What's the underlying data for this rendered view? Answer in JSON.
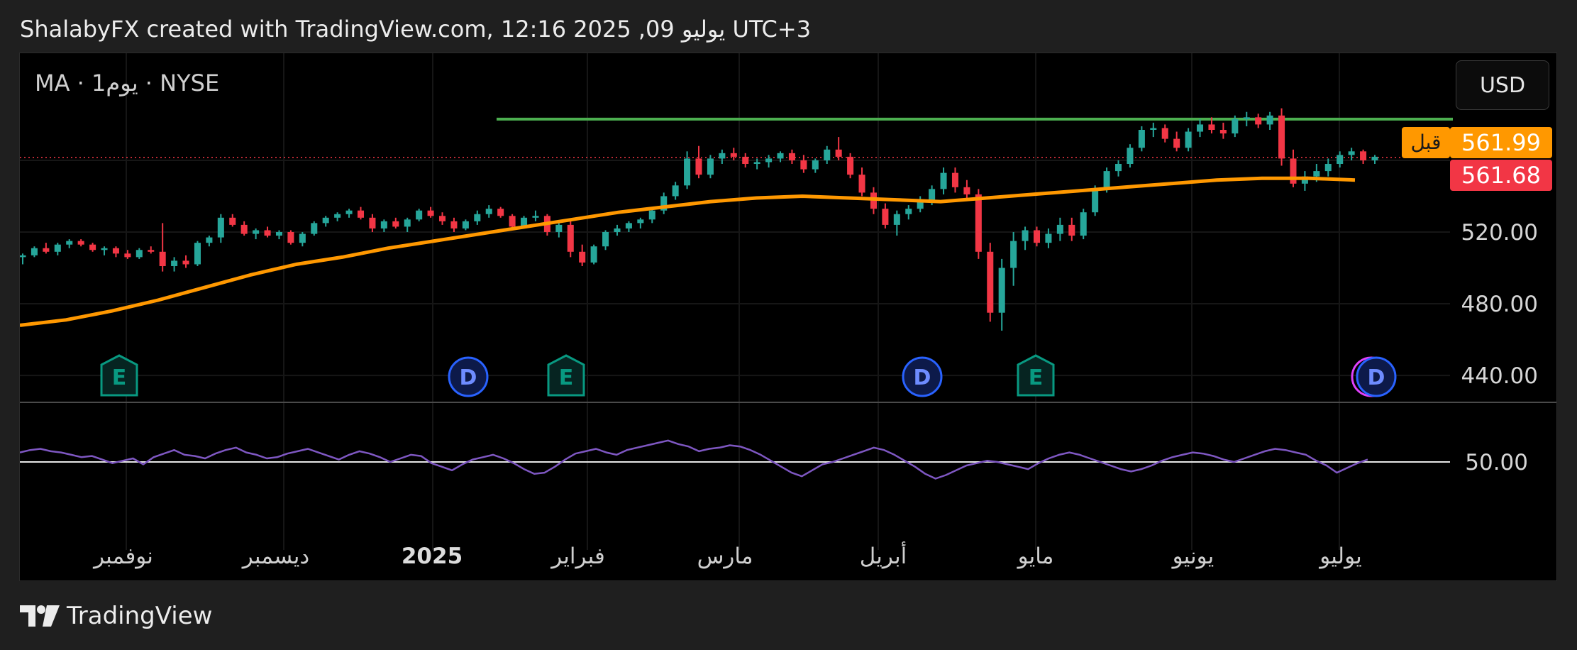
{
  "header": {
    "caption": "ShalabyFX created with TradingView.com, 12:16 2025 ,09 يوليو UTC+3"
  },
  "chart": {
    "symbol_label": "MA · 1يوم · NYSE",
    "currency": "USD",
    "prev_close_label": "قبل",
    "prev_close_value": "561.99",
    "last_price_value": "561.68",
    "colors": {
      "up": "#26a69a",
      "down": "#f23645",
      "ma": "#ff9800",
      "resistance": "#4caf50",
      "rsi": "#7e57c2",
      "prev_badge": "#ff9800",
      "last_badge": "#f23645",
      "dividend_marker": "#2962ff",
      "earnings_marker": "#089981"
    }
  },
  "chart_data": {
    "type": "line",
    "panes": [
      {
        "name": "price",
        "y_ticks": [
          "520.00",
          "480.00",
          "440.00"
        ],
        "y_tick_values": [
          520,
          480,
          440
        ],
        "ylim": [
          425,
          596
        ],
        "candles_ohlc": [
          [
            506,
            508,
            502,
            507
          ],
          [
            507,
            512,
            506,
            511
          ],
          [
            511,
            514,
            508,
            509
          ],
          [
            509,
            514,
            507,
            513
          ],
          [
            513,
            516,
            511,
            515
          ],
          [
            515,
            516,
            512,
            513
          ],
          [
            513,
            514,
            509,
            510
          ],
          [
            510,
            512,
            507,
            511
          ],
          [
            511,
            512,
            506,
            508
          ],
          [
            508,
            510,
            505,
            506
          ],
          [
            506,
            511,
            505,
            510
          ],
          [
            510,
            512,
            508,
            509
          ],
          [
            509,
            525,
            498,
            501
          ],
          [
            501,
            506,
            498,
            504
          ],
          [
            504,
            507,
            500,
            502
          ],
          [
            502,
            515,
            501,
            514
          ],
          [
            514,
            518,
            512,
            517
          ],
          [
            517,
            530,
            514,
            528
          ],
          [
            528,
            530,
            523,
            524
          ],
          [
            524,
            526,
            518,
            519
          ],
          [
            519,
            522,
            516,
            521
          ],
          [
            521,
            523,
            517,
            518
          ],
          [
            518,
            521,
            516,
            520
          ],
          [
            520,
            521,
            513,
            514
          ],
          [
            514,
            520,
            512,
            519
          ],
          [
            519,
            526,
            518,
            525
          ],
          [
            525,
            529,
            523,
            528
          ],
          [
            528,
            531,
            526,
            530
          ],
          [
            530,
            533,
            528,
            532
          ],
          [
            532,
            534,
            527,
            528
          ],
          [
            528,
            530,
            520,
            522
          ],
          [
            522,
            527,
            520,
            526
          ],
          [
            526,
            528,
            522,
            523
          ],
          [
            523,
            528,
            520,
            527
          ],
          [
            527,
            533,
            526,
            532
          ],
          [
            532,
            534,
            528,
            529
          ],
          [
            529,
            531,
            524,
            526
          ],
          [
            526,
            528,
            520,
            522
          ],
          [
            522,
            527,
            521,
            526
          ],
          [
            526,
            532,
            524,
            530
          ],
          [
            530,
            535,
            528,
            533
          ],
          [
            533,
            534,
            528,
            529
          ],
          [
            529,
            530,
            521,
            523
          ],
          [
            523,
            529,
            522,
            528
          ],
          [
            528,
            532,
            526,
            529
          ],
          [
            529,
            530,
            518,
            520
          ],
          [
            520,
            526,
            517,
            524
          ],
          [
            524,
            526,
            506,
            509
          ],
          [
            509,
            513,
            501,
            503
          ],
          [
            503,
            513,
            502,
            512
          ],
          [
            512,
            521,
            510,
            520
          ],
          [
            520,
            524,
            518,
            522
          ],
          [
            522,
            526,
            520,
            525
          ],
          [
            525,
            528,
            522,
            527
          ],
          [
            527,
            534,
            525,
            532
          ],
          [
            532,
            542,
            530,
            540
          ],
          [
            540,
            548,
            538,
            546
          ],
          [
            546,
            565,
            544,
            561
          ],
          [
            561,
            568,
            550,
            552
          ],
          [
            552,
            563,
            550,
            561
          ],
          [
            561,
            566,
            558,
            564
          ],
          [
            564,
            567,
            560,
            562
          ],
          [
            562,
            564,
            556,
            558
          ],
          [
            558,
            561,
            555,
            559
          ],
          [
            559,
            563,
            556,
            561
          ],
          [
            561,
            565,
            559,
            564
          ],
          [
            564,
            566,
            558,
            560
          ],
          [
            560,
            563,
            553,
            555
          ],
          [
            555,
            561,
            553,
            560
          ],
          [
            560,
            568,
            558,
            566
          ],
          [
            566,
            573,
            560,
            562
          ],
          [
            562,
            564,
            550,
            552
          ],
          [
            552,
            556,
            540,
            542
          ],
          [
            542,
            545,
            530,
            533
          ],
          [
            533,
            536,
            522,
            524
          ],
          [
            524,
            532,
            518,
            530
          ],
          [
            530,
            535,
            527,
            533
          ],
          [
            533,
            540,
            531,
            538
          ],
          [
            538,
            546,
            535,
            544
          ],
          [
            544,
            556,
            541,
            553
          ],
          [
            553,
            556,
            542,
            545
          ],
          [
            545,
            549,
            538,
            541
          ],
          [
            541,
            544,
            505,
            509
          ],
          [
            509,
            514,
            470,
            475
          ],
          [
            475,
            505,
            465,
            500
          ],
          [
            500,
            520,
            490,
            515
          ],
          [
            515,
            523,
            510,
            521
          ],
          [
            521,
            523,
            512,
            514
          ],
          [
            514,
            522,
            511,
            519
          ],
          [
            519,
            528,
            515,
            524
          ],
          [
            524,
            528,
            515,
            518
          ],
          [
            518,
            533,
            516,
            531
          ],
          [
            531,
            546,
            529,
            544
          ],
          [
            544,
            556,
            542,
            554
          ],
          [
            554,
            560,
            551,
            558
          ],
          [
            558,
            569,
            556,
            567
          ],
          [
            567,
            579,
            565,
            577
          ],
          [
            577,
            581,
            573,
            578
          ],
          [
            578,
            580,
            570,
            572
          ],
          [
            572,
            576,
            565,
            567
          ],
          [
            567,
            578,
            565,
            576
          ],
          [
            576,
            583,
            573,
            580
          ],
          [
            580,
            584,
            575,
            577
          ],
          [
            577,
            581,
            572,
            575
          ],
          [
            575,
            585,
            573,
            583
          ],
          [
            583,
            587,
            579,
            584
          ],
          [
            584,
            586,
            578,
            580
          ],
          [
            580,
            587,
            577,
            585
          ],
          [
            585,
            589,
            557,
            561
          ],
          [
            561,
            566,
            545,
            547
          ],
          [
            547,
            554,
            543,
            551
          ],
          [
            551,
            558,
            548,
            554
          ],
          [
            554,
            561,
            551,
            558
          ],
          [
            558,
            565,
            556,
            563
          ],
          [
            563,
            567,
            560,
            565
          ],
          [
            565,
            566,
            558,
            560
          ],
          [
            560,
            563,
            558,
            562
          ]
        ],
        "ma_series": [
          468,
          471,
          476,
          482,
          489,
          496,
          502,
          506,
          511,
          515,
          519,
          523,
          527,
          531,
          534,
          537,
          539,
          540,
          539,
          538,
          537,
          539,
          541,
          543,
          545,
          547,
          549,
          550,
          550,
          549
        ]
      },
      {
        "name": "rsi",
        "y_ticks": [
          "50.00"
        ],
        "y_tick_values": [
          50
        ],
        "ylim": [
          0,
          100
        ],
        "values": [
          58,
          60,
          61,
          59,
          58,
          56,
          54,
          55,
          52,
          49,
          51,
          53,
          48,
          54,
          57,
          60,
          56,
          55,
          53,
          57,
          60,
          62,
          58,
          56,
          53,
          54,
          57,
          59,
          61,
          58,
          55,
          52,
          56,
          59,
          57,
          54,
          50,
          53,
          56,
          55,
          49,
          46,
          43,
          48,
          52,
          54,
          56,
          53,
          49,
          44,
          40,
          41,
          46,
          52,
          57,
          59,
          61,
          58,
          56,
          60,
          62,
          64,
          66,
          68,
          65,
          63,
          59,
          61,
          62,
          64,
          63,
          60,
          56,
          51,
          46,
          41,
          38,
          43,
          48,
          50,
          53,
          56,
          59,
          62,
          60,
          56,
          51,
          46,
          40,
          36,
          39,
          43,
          47,
          49,
          51,
          50,
          48,
          46,
          44,
          49,
          53,
          56,
          58,
          56,
          53,
          50,
          47,
          44,
          42,
          44,
          47,
          51,
          54,
          56,
          58,
          57,
          55,
          52,
          50,
          53,
          56,
          59,
          61,
          60,
          58,
          56,
          51,
          47,
          41,
          45,
          49,
          52
        ]
      }
    ],
    "x_tick_labels": [
      "نوفمبر",
      "ديسمبر",
      "2025",
      "فبراير",
      "مارس",
      "أبريل",
      "مايو",
      "يونيو",
      "يوليو"
    ],
    "resistance_level": 583,
    "last_price": 561.68,
    "prev_close": 561.99,
    "event_markers": [
      "E",
      "D",
      "E",
      "D",
      "E",
      "D"
    ],
    "grid": true
  },
  "footer": {
    "brand": "TradingView"
  }
}
